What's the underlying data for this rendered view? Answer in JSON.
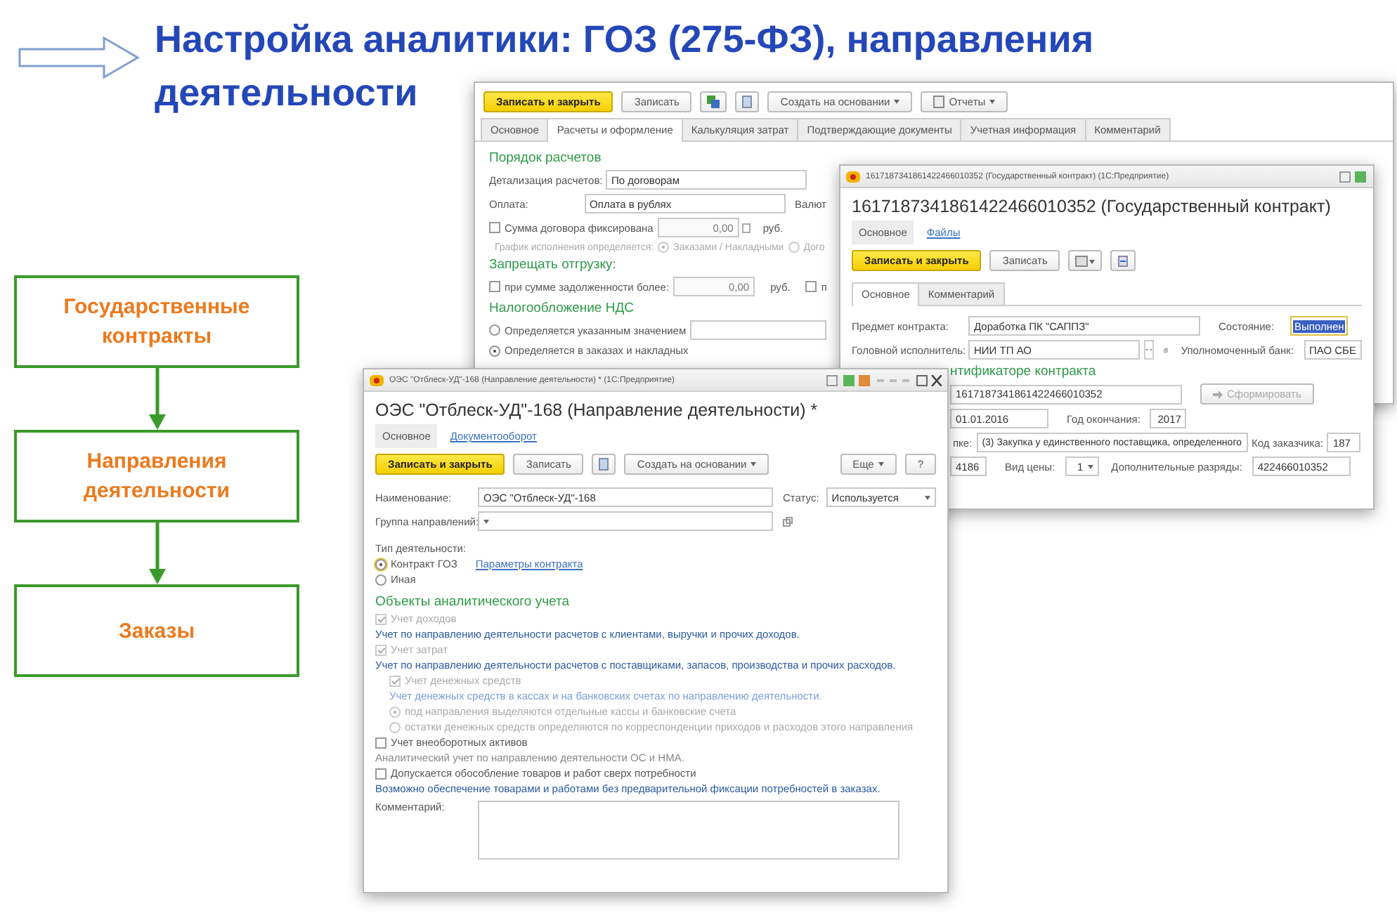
{
  "slide": {
    "title_lines": [
      "Настройка аналитики: ГОЗ (275-ФЗ), направления",
      "деятельности"
    ]
  },
  "flow": [
    {
      "label": "Государственные контракты"
    },
    {
      "label": "Направления деятельности"
    },
    {
      "label": "Заказы"
    }
  ],
  "settlement_window": {
    "toolbar": {
      "primary": "Записать и закрыть",
      "secondary": "Записать",
      "create": "Создать на основании",
      "reports": "Отчеты"
    },
    "tabs": [
      {
        "label": "Основное",
        "selected": false
      },
      {
        "label": "Расчеты и оформление",
        "selected": true
      },
      {
        "label": "Калькуляция затрат",
        "selected": false
      },
      {
        "label": "Подтверждающие документы",
        "selected": false
      },
      {
        "label": "Учетная информация",
        "selected": false
      },
      {
        "label": "Комментарий",
        "selected": false
      }
    ],
    "rows": [
      {
        "kind": "section",
        "text": "Порядок расчетов"
      },
      {
        "kind": "field",
        "label": "Детализация расчетов:",
        "value": "По договорам"
      },
      {
        "kind": "field",
        "label": "Оплата:",
        "value": "Оплата в рублях",
        "after": "Валют"
      },
      {
        "kind": "amount",
        "label": "Сумма договора фиксирована",
        "checked": false,
        "value": "0,00",
        "unit": "руб."
      },
      {
        "kind": "radios",
        "label": "График исполнения определяется:",
        "options": [
          {
            "label": "Заказами / Накладными",
            "selected": true
          },
          {
            "label": "Дого",
            "selected": false
          }
        ]
      },
      {
        "kind": "section",
        "text": "Запрещать отгрузку:"
      },
      {
        "kind": "amount",
        "label": "при сумме задолженности более:",
        "checked": false,
        "value": "0,00",
        "unit": "руб.",
        "extra": {
          "label": "п",
          "checked": false
        }
      },
      {
        "kind": "section",
        "text": "Налогообложение НДС"
      },
      {
        "kind": "radio",
        "label": "Определяется указанным значением",
        "selected": false,
        "field": true
      },
      {
        "kind": "radio",
        "label": "Определяется в заказах и накладных",
        "selected": true
      }
    ]
  },
  "contract_window": {
    "title_bar": "1617187341861422466010352 (Государственный контракт) (1С:Предприятие)",
    "heading": "1617187341861422466010352 (Государственный контракт)",
    "nav": [
      {
        "label": "Основное",
        "selected": true
      },
      {
        "label": "Файлы",
        "selected": false
      }
    ],
    "toolbar": {
      "primary": "Записать и закрыть",
      "secondary": "Записать"
    },
    "tabs": [
      {
        "label": "Основное",
        "selected": true
      },
      {
        "label": "Комментарий",
        "selected": false
      }
    ],
    "subject": {
      "label": "Предмет контракта:",
      "value": "Доработка ПК \"САППЗ\""
    },
    "state": {
      "label": "Состояние:",
      "value": "Выполнен"
    },
    "contractor": {
      "label": "Головной исполнитель:",
      "value": "НИИ ТП АО"
    },
    "bank": {
      "label": "Уполномоченный банк:",
      "value": "ПАО СБЕ"
    },
    "id_section": "нтификаторе контракта",
    "id_value": "1617187341861422466010352",
    "generate_button": {
      "label": "Сформировать",
      "disabled": true
    },
    "start_date": "01.01.2016",
    "end_year": {
      "label": "Год окончания:",
      "value": "2017"
    },
    "purchase": {
      "label": "пке:",
      "value": "(3) Закупка у единственного поставщика, определенного"
    },
    "customer_code": {
      "label": "Код заказчика:",
      "value": "187"
    },
    "code": "4186",
    "price_type": {
      "label": "Вид цены:",
      "value": "1"
    },
    "extra_digits": {
      "label": "Дополнительные разряды:",
      "value": "422466010352"
    }
  },
  "direction_window": {
    "title_bar": "ОЭС \"Отблеск-УД\"-168 (Направление деятельности) * (1С:Предприятие)",
    "heading": "ОЭС \"Отблеск-УД\"-168 (Направление деятельности) *",
    "nav": [
      {
        "label": "Основное",
        "selected": true
      },
      {
        "label": "Документооборот",
        "selected": false
      }
    ],
    "toolbar": {
      "primary": "Записать и закрыть",
      "secondary": "Записать",
      "create": "Создать на основании",
      "more": "Еще",
      "help": "?"
    },
    "name": {
      "label": "Наименование:",
      "value": "ОЭС \"Отблеск-УД\"-168"
    },
    "status": {
      "label": "Статус:",
      "value": "Используется"
    },
    "group": {
      "label": "Группа направлений:"
    },
    "activity_type": {
      "label": "Тип деятельности:",
      "options": [
        {
          "label": "Контракт ГОЗ",
          "selected": true,
          "link": "Параметры контракта"
        },
        {
          "label": "Иная",
          "selected": false
        }
      ]
    },
    "objects_title": "Объекты аналитического учета",
    "objects": [
      {
        "label": "Учет доходов",
        "checked": true,
        "disabled": true,
        "note": {
          "text": "Учет по направлению деятельности расчетов с клиентами, выручки и прочих доходов.",
          "color": "#2b5aa0"
        }
      },
      {
        "label": "Учет затрат",
        "checked": true,
        "disabled": true,
        "note": {
          "text": "Учет по направлению деятельности расчетов с поставщиками, запасов, производства и прочих расходов.",
          "color": "#2b5aa0"
        },
        "children": [
          {
            "label": "Учет денежных средств",
            "checked": true,
            "disabled": true,
            "note": {
              "text": "Учет денежных средств в кассах и на банковских счетах по направлению деятельности.",
              "color": "#7aa0d8"
            },
            "options": [
              {
                "label": "под направления выделяются отдельные кассы и банковские счета",
                "selected": true
              },
              {
                "label": "остатки денежных средств определяются по корреспонденции приходов и расходов этого направления",
                "selected": false
              }
            ]
          }
        ]
      },
      {
        "label": "Учет внеоборотных активов",
        "checked": false,
        "disabled": false,
        "note": {
          "text": "Аналитический учет по направлению деятельности ОС и НМА.",
          "color": "#888888"
        }
      },
      {
        "label": "Допускается обособление товаров и работ сверх потребности",
        "checked": false,
        "disabled": false,
        "note": {
          "text": "Возможно обеспечение товарами и работами без предварительной фиксации потребностей в заказах.",
          "color": "#2b5aa0"
        }
      }
    ],
    "comment": {
      "label": "Комментарий:"
    }
  }
}
